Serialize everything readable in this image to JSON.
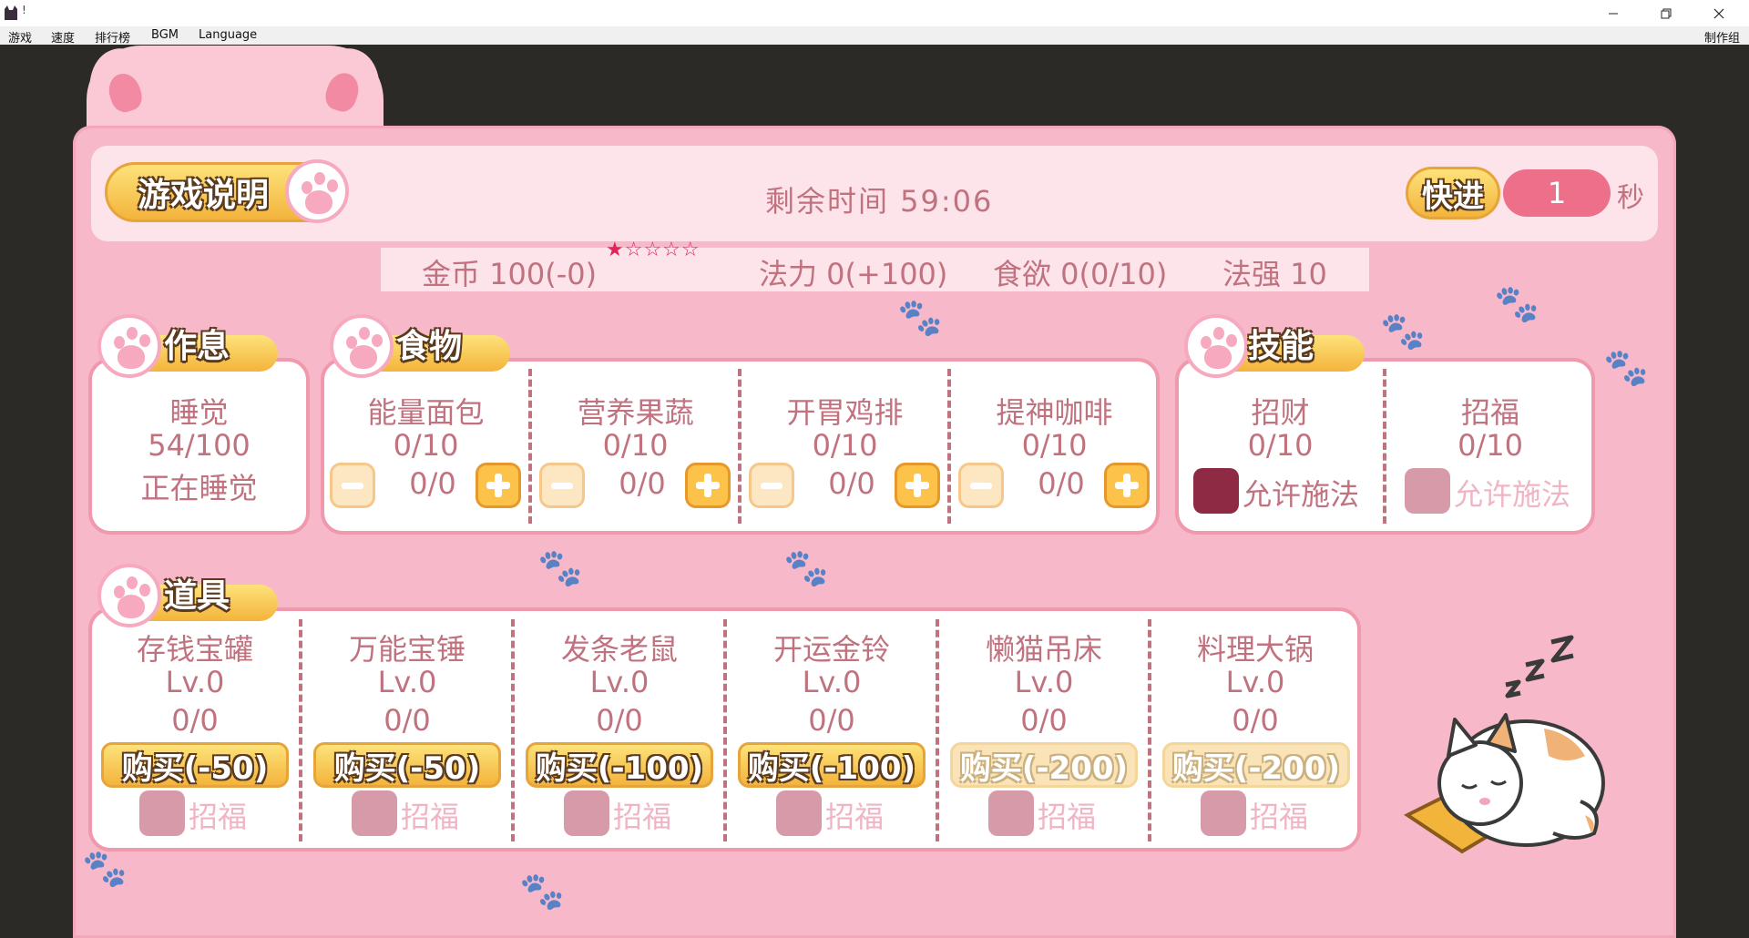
{
  "window": {
    "title": "!",
    "menus": [
      "游戏",
      "速度",
      "排行榜",
      "BGM",
      "Language"
    ],
    "credits": "制作组"
  },
  "header": {
    "help_label": "游戏说明",
    "time_label": "剩余时间 59:06",
    "fast_forward_label": "快进",
    "fast_forward_value": "1",
    "fast_forward_unit": "秒"
  },
  "stats": {
    "gold": "金币 100(-0)",
    "stars": "★☆☆☆☆",
    "mana": "法力 0(+100)",
    "appetite": "食欲 0(0/10)",
    "power": "法强 10"
  },
  "rest": {
    "title": "作息",
    "name": "睡觉",
    "value": "54/100",
    "status": "正在睡觉"
  },
  "food": {
    "title": "食物",
    "items": [
      {
        "name": "能量面包",
        "count": "0/10",
        "qty": "0/0"
      },
      {
        "name": "营养果蔬",
        "count": "0/10",
        "qty": "0/0"
      },
      {
        "name": "开胃鸡排",
        "count": "0/10",
        "qty": "0/0"
      },
      {
        "name": "提神咖啡",
        "count": "0/10",
        "qty": "0/0"
      }
    ]
  },
  "skills": {
    "title": "技能",
    "items": [
      {
        "name": "招财",
        "count": "0/10",
        "toggle_label": "允许施法",
        "checked": true
      },
      {
        "name": "招福",
        "count": "0/10",
        "toggle_label": "允许施法",
        "checked": false
      }
    ]
  },
  "props": {
    "title": "道具",
    "items": [
      {
        "name": "存钱宝罐",
        "level": "Lv.0",
        "count": "0/0",
        "buy": "购买(-50)",
        "toggle": "招福",
        "enabled": true
      },
      {
        "name": "万能宝锤",
        "level": "Lv.0",
        "count": "0/0",
        "buy": "购买(-50)",
        "toggle": "招福",
        "enabled": true
      },
      {
        "name": "发条老鼠",
        "level": "Lv.0",
        "count": "0/0",
        "buy": "购买(-100)",
        "toggle": "招福",
        "enabled": true
      },
      {
        "name": "开运金铃",
        "level": "Lv.0",
        "count": "0/0",
        "buy": "购买(-100)",
        "toggle": "招福",
        "enabled": true
      },
      {
        "name": "懒猫吊床",
        "level": "Lv.0",
        "count": "0/0",
        "buy": "购买(-200)",
        "toggle": "招福",
        "enabled": false
      },
      {
        "name": "料理大锅",
        "level": "Lv.0",
        "count": "0/0",
        "buy": "购买(-200)",
        "toggle": "招福",
        "enabled": false
      }
    ]
  },
  "colors": {
    "board": "#f7b9c9",
    "text": "#c0727f",
    "accent": "#ee6f8a",
    "button": "#f3b43c",
    "checked": "#8e2a44",
    "unchecked": "#d79aa8"
  },
  "icons": [
    "cat-app-icon",
    "paw-icon",
    "sleeping-cat-icon",
    "zzz-icon"
  ]
}
